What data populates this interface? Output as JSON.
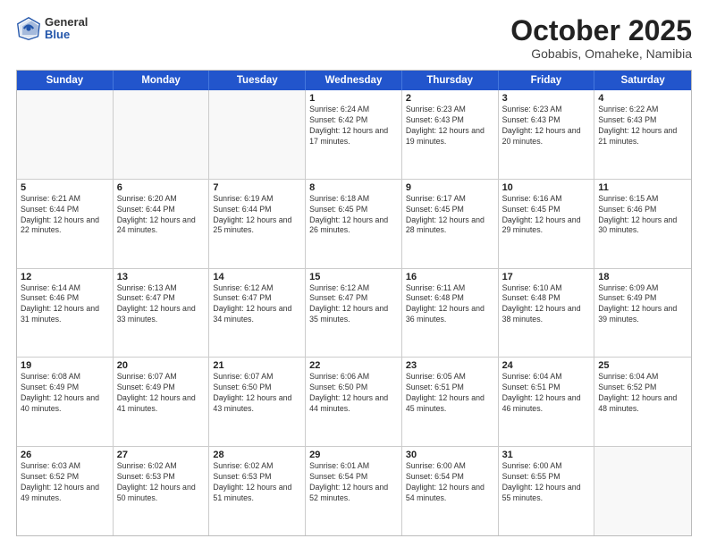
{
  "header": {
    "logo_general": "General",
    "logo_blue": "Blue",
    "month": "October 2025",
    "location": "Gobabis, Omaheke, Namibia"
  },
  "days_of_week": [
    "Sunday",
    "Monday",
    "Tuesday",
    "Wednesday",
    "Thursday",
    "Friday",
    "Saturday"
  ],
  "rows": [
    [
      {
        "day": "",
        "empty": true
      },
      {
        "day": "",
        "empty": true
      },
      {
        "day": "",
        "empty": true
      },
      {
        "day": "1",
        "sunrise": "6:24 AM",
        "sunset": "6:42 PM",
        "daylight": "12 hours and 17 minutes."
      },
      {
        "day": "2",
        "sunrise": "6:23 AM",
        "sunset": "6:43 PM",
        "daylight": "12 hours and 19 minutes."
      },
      {
        "day": "3",
        "sunrise": "6:23 AM",
        "sunset": "6:43 PM",
        "daylight": "12 hours and 20 minutes."
      },
      {
        "day": "4",
        "sunrise": "6:22 AM",
        "sunset": "6:43 PM",
        "daylight": "12 hours and 21 minutes."
      }
    ],
    [
      {
        "day": "5",
        "sunrise": "6:21 AM",
        "sunset": "6:44 PM",
        "daylight": "12 hours and 22 minutes."
      },
      {
        "day": "6",
        "sunrise": "6:20 AM",
        "sunset": "6:44 PM",
        "daylight": "12 hours and 24 minutes."
      },
      {
        "day": "7",
        "sunrise": "6:19 AM",
        "sunset": "6:44 PM",
        "daylight": "12 hours and 25 minutes."
      },
      {
        "day": "8",
        "sunrise": "6:18 AM",
        "sunset": "6:45 PM",
        "daylight": "12 hours and 26 minutes."
      },
      {
        "day": "9",
        "sunrise": "6:17 AM",
        "sunset": "6:45 PM",
        "daylight": "12 hours and 28 minutes."
      },
      {
        "day": "10",
        "sunrise": "6:16 AM",
        "sunset": "6:45 PM",
        "daylight": "12 hours and 29 minutes."
      },
      {
        "day": "11",
        "sunrise": "6:15 AM",
        "sunset": "6:46 PM",
        "daylight": "12 hours and 30 minutes."
      }
    ],
    [
      {
        "day": "12",
        "sunrise": "6:14 AM",
        "sunset": "6:46 PM",
        "daylight": "12 hours and 31 minutes."
      },
      {
        "day": "13",
        "sunrise": "6:13 AM",
        "sunset": "6:47 PM",
        "daylight": "12 hours and 33 minutes."
      },
      {
        "day": "14",
        "sunrise": "6:12 AM",
        "sunset": "6:47 PM",
        "daylight": "12 hours and 34 minutes."
      },
      {
        "day": "15",
        "sunrise": "6:12 AM",
        "sunset": "6:47 PM",
        "daylight": "12 hours and 35 minutes."
      },
      {
        "day": "16",
        "sunrise": "6:11 AM",
        "sunset": "6:48 PM",
        "daylight": "12 hours and 36 minutes."
      },
      {
        "day": "17",
        "sunrise": "6:10 AM",
        "sunset": "6:48 PM",
        "daylight": "12 hours and 38 minutes."
      },
      {
        "day": "18",
        "sunrise": "6:09 AM",
        "sunset": "6:49 PM",
        "daylight": "12 hours and 39 minutes."
      }
    ],
    [
      {
        "day": "19",
        "sunrise": "6:08 AM",
        "sunset": "6:49 PM",
        "daylight": "12 hours and 40 minutes."
      },
      {
        "day": "20",
        "sunrise": "6:07 AM",
        "sunset": "6:49 PM",
        "daylight": "12 hours and 41 minutes."
      },
      {
        "day": "21",
        "sunrise": "6:07 AM",
        "sunset": "6:50 PM",
        "daylight": "12 hours and 43 minutes."
      },
      {
        "day": "22",
        "sunrise": "6:06 AM",
        "sunset": "6:50 PM",
        "daylight": "12 hours and 44 minutes."
      },
      {
        "day": "23",
        "sunrise": "6:05 AM",
        "sunset": "6:51 PM",
        "daylight": "12 hours and 45 minutes."
      },
      {
        "day": "24",
        "sunrise": "6:04 AM",
        "sunset": "6:51 PM",
        "daylight": "12 hours and 46 minutes."
      },
      {
        "day": "25",
        "sunrise": "6:04 AM",
        "sunset": "6:52 PM",
        "daylight": "12 hours and 48 minutes."
      }
    ],
    [
      {
        "day": "26",
        "sunrise": "6:03 AM",
        "sunset": "6:52 PM",
        "daylight": "12 hours and 49 minutes."
      },
      {
        "day": "27",
        "sunrise": "6:02 AM",
        "sunset": "6:53 PM",
        "daylight": "12 hours and 50 minutes."
      },
      {
        "day": "28",
        "sunrise": "6:02 AM",
        "sunset": "6:53 PM",
        "daylight": "12 hours and 51 minutes."
      },
      {
        "day": "29",
        "sunrise": "6:01 AM",
        "sunset": "6:54 PM",
        "daylight": "12 hours and 52 minutes."
      },
      {
        "day": "30",
        "sunrise": "6:00 AM",
        "sunset": "6:54 PM",
        "daylight": "12 hours and 54 minutes."
      },
      {
        "day": "31",
        "sunrise": "6:00 AM",
        "sunset": "6:55 PM",
        "daylight": "12 hours and 55 minutes."
      },
      {
        "day": "",
        "empty": true
      }
    ]
  ]
}
